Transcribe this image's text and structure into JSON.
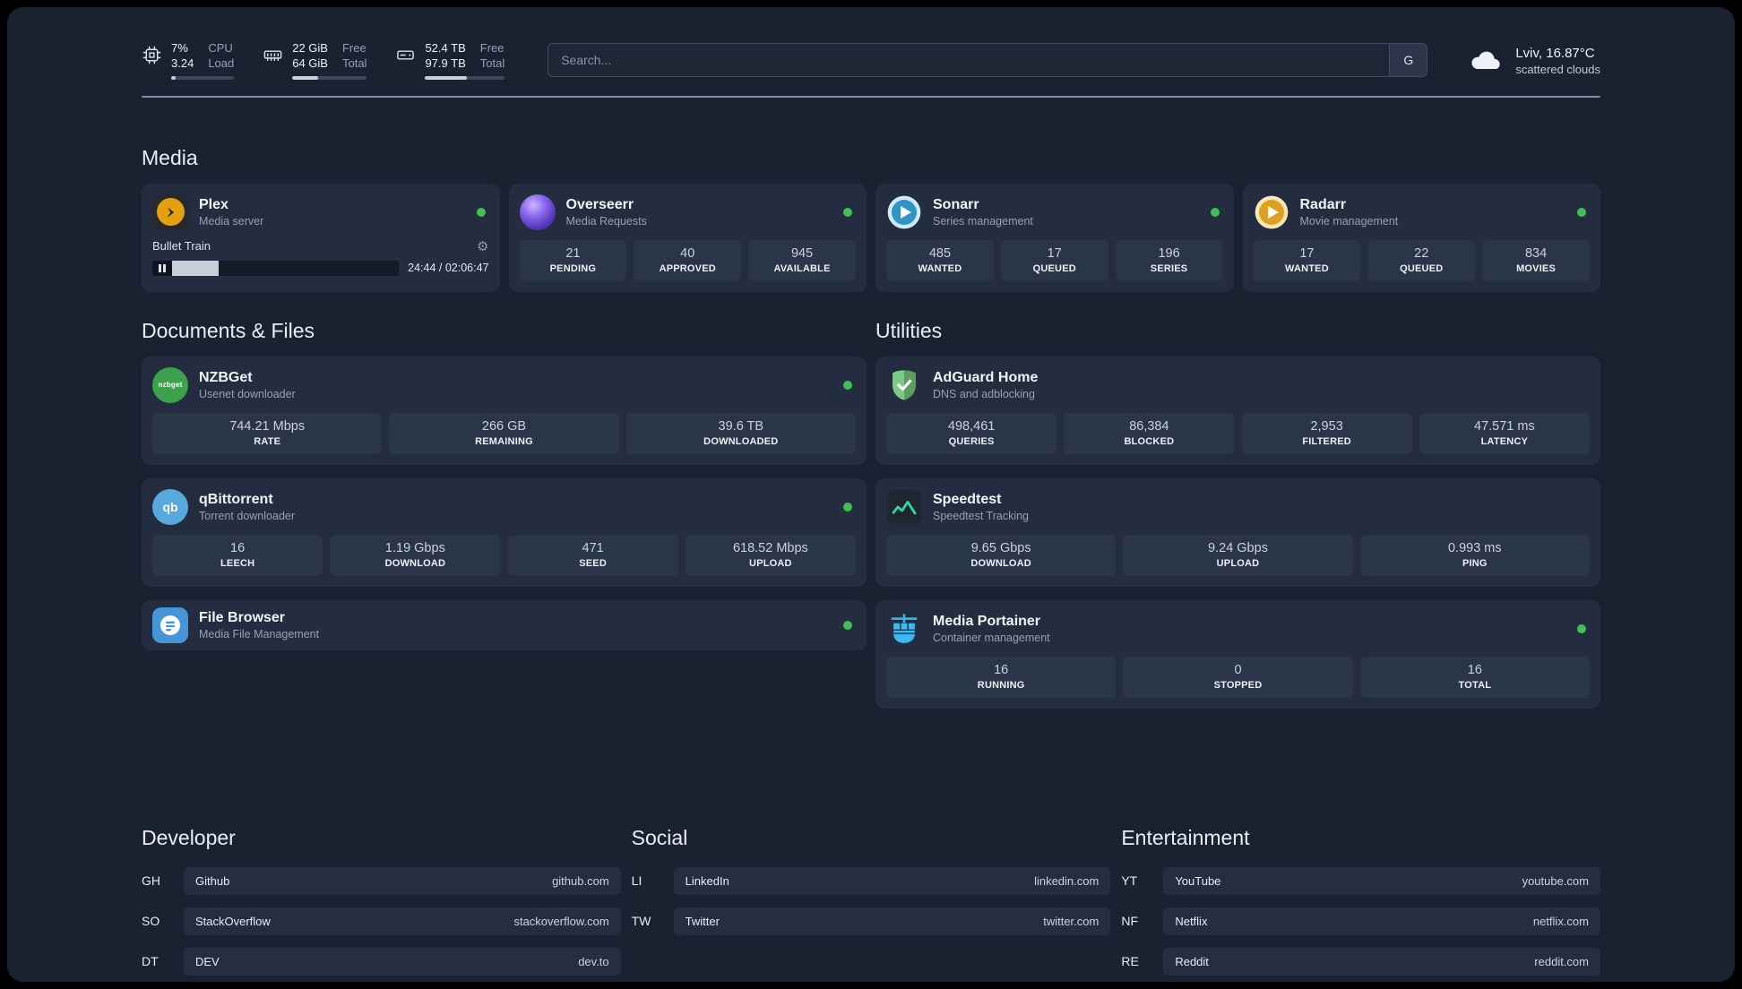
{
  "topbar": {
    "cpu": {
      "value_top": "7%",
      "value_bottom": "3.24",
      "label_top": "CPU",
      "label_bottom": "Load",
      "progress": 7
    },
    "memory": {
      "value_top": "22 GiB",
      "value_bottom": "64 GiB",
      "label_top": "Free",
      "label_bottom": "Total",
      "progress": 34
    },
    "storage": {
      "value_top": "52.4 TB",
      "value_bottom": "97.9 TB",
      "label_top": "Free",
      "label_bottom": "Total",
      "progress": 53
    },
    "search": {
      "placeholder": "Search...",
      "engine_label": "G"
    },
    "weather": {
      "location": "Lviv, 16.87°C",
      "condition": "scattered clouds"
    }
  },
  "sections": {
    "media": "Media",
    "documents": "Documents & Files",
    "utilities": "Utilities",
    "developer": "Developer",
    "social": "Social",
    "entertainment": "Entertainment"
  },
  "icons": {
    "settings_gear": "⚙"
  },
  "apps": {
    "plex": {
      "name": "Plex",
      "subtitle": "Media server",
      "now_playing": "Bullet Train",
      "timestamp": "24:44 / 02:06:47",
      "progress": 19
    },
    "overseerr": {
      "name": "Overseerr",
      "subtitle": "Media Requests",
      "stats": [
        {
          "value": "21",
          "label": "PENDING"
        },
        {
          "value": "40",
          "label": "APPROVED"
        },
        {
          "value": "945",
          "label": "AVAILABLE"
        }
      ]
    },
    "sonarr": {
      "name": "Sonarr",
      "subtitle": "Series management",
      "stats": [
        {
          "value": "485",
          "label": "WANTED"
        },
        {
          "value": "17",
          "label": "QUEUED"
        },
        {
          "value": "196",
          "label": "SERIES"
        }
      ]
    },
    "radarr": {
      "name": "Radarr",
      "subtitle": "Movie management",
      "stats": [
        {
          "value": "17",
          "label": "WANTED"
        },
        {
          "value": "22",
          "label": "QUEUED"
        },
        {
          "value": "834",
          "label": "MOVIES"
        }
      ]
    },
    "nzbget": {
      "name": "NZBGet",
      "subtitle": "Usenet downloader",
      "icon_text": "nzbget",
      "stats": [
        {
          "value": "744.21 Mbps",
          "label": "RATE"
        },
        {
          "value": "266 GB",
          "label": "REMAINING"
        },
        {
          "value": "39.6 TB",
          "label": "DOWNLOADED"
        }
      ]
    },
    "qbittorrent": {
      "name": "qBittorrent",
      "subtitle": "Torrent downloader",
      "icon_text": "qb",
      "stats": [
        {
          "value": "16",
          "label": "LEECH"
        },
        {
          "value": "1.19 Gbps",
          "label": "DOWNLOAD"
        },
        {
          "value": "471",
          "label": "SEED"
        },
        {
          "value": "618.52 Mbps",
          "label": "UPLOAD"
        }
      ]
    },
    "filebrowser": {
      "name": "File Browser",
      "subtitle": "Media File Management"
    },
    "adguard": {
      "name": "AdGuard Home",
      "subtitle": "DNS and adblocking",
      "stats": [
        {
          "value": "498,461",
          "label": "QUERIES"
        },
        {
          "value": "86,384",
          "label": "BLOCKED"
        },
        {
          "value": "2,953",
          "label": "FILTERED"
        },
        {
          "value": "47.571 ms",
          "label": "LATENCY"
        }
      ]
    },
    "speedtest": {
      "name": "Speedtest",
      "subtitle": "Speedtest Tracking",
      "stats": [
        {
          "value": "9.65 Gbps",
          "label": "DOWNLOAD"
        },
        {
          "value": "9.24 Gbps",
          "label": "UPLOAD"
        },
        {
          "value": "0.993 ms",
          "label": "PING"
        }
      ]
    },
    "portainer": {
      "name": "Media Portainer",
      "subtitle": "Container management",
      "stats": [
        {
          "value": "16",
          "label": "RUNNING"
        },
        {
          "value": "0",
          "label": "STOPPED"
        },
        {
          "value": "16",
          "label": "TOTAL"
        }
      ]
    }
  },
  "bookmarks": {
    "developer": [
      {
        "abbr": "GH",
        "name": "Github",
        "url": "github.com"
      },
      {
        "abbr": "SO",
        "name": "StackOverflow",
        "url": "stackoverflow.com"
      },
      {
        "abbr": "DT",
        "name": "DEV",
        "url": "dev.to"
      }
    ],
    "social": [
      {
        "abbr": "LI",
        "name": "LinkedIn",
        "url": "linkedin.com"
      },
      {
        "abbr": "TW",
        "name": "Twitter",
        "url": "twitter.com"
      }
    ],
    "entertainment": [
      {
        "abbr": "YT",
        "name": "YouTube",
        "url": "youtube.com"
      },
      {
        "abbr": "NF",
        "name": "Netflix",
        "url": "netflix.com"
      },
      {
        "abbr": "RE",
        "name": "Reddit",
        "url": "reddit.com"
      }
    ]
  },
  "colors": {
    "background": "#1a2232",
    "card": "#242d3f",
    "stat_box": "#2b3548",
    "status_online": "#40c057",
    "plex_accent": "#e5a00d",
    "overseerr_accent": "#8f6df0",
    "sonarr_accent": "#3095c6",
    "radarr_accent": "#dfa022",
    "nzbget_accent": "#3da14b",
    "qbittorrent_accent": "#57a8dc",
    "filebrowser_accent": "#4595d8",
    "adguard_accent": "#7dc98a",
    "speedtest_accent": "#35d49a",
    "portainer_accent": "#3db9f2"
  }
}
